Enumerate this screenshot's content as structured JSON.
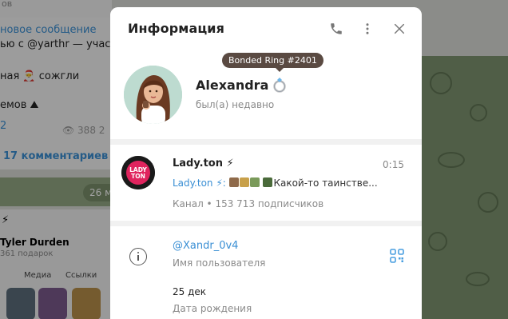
{
  "background": {
    "top_text": "ов",
    "msg_line1": "новое сообщение",
    "msg_line2": "ью с @yarthr — участн",
    "msg_line3": "ная 🎅 сожгли",
    "msg_line4": "емов ⛰",
    "msg_badge": "2",
    "views": "👁 388",
    "views_extra": "2",
    "comments": "17 комментариев",
    "date_pill": "26 м",
    "profile_name": "Tyler Durden",
    "profile_sub": "361 подарок",
    "tab_media": "Медиа",
    "tab_links": "Ссылки"
  },
  "modal": {
    "title": "Информация",
    "profile": {
      "name": "Alexandra",
      "status": "был(а) недавно",
      "badge_tooltip": "Bonded Ring #2401"
    },
    "channel": {
      "name": "Lady.ton ⚡",
      "time": "0:15",
      "preview_prefix": "Lady.ton ⚡:",
      "preview_text": "Какой-то таинстве...",
      "subtitle": "Канал • 153 713 подписчиков",
      "avatar_text_1": "LADY",
      "avatar_text_2": "TON"
    },
    "info": {
      "username": "@Xandr_0v4",
      "username_label": "Имя пользователя",
      "birthday": "25 дек",
      "birthday_label": "Дата рождения"
    }
  },
  "colors": {
    "accent": "#3a8fd4",
    "tooltip_bg": "#5a4a42",
    "qr_icon": "#4a9fe0"
  }
}
